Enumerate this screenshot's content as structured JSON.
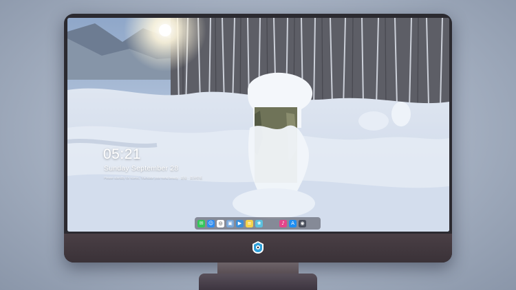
{
  "lock_screen": {
    "time": "05:21",
    "date": "Sunday September  28",
    "subtitle": "Please standby for scenic, Translate your mind beauty · 超级 · 高清壁纸"
  },
  "dock": {
    "apps": [
      {
        "name": "messages",
        "color": "#34c759",
        "glyph": "✉"
      },
      {
        "name": "finder",
        "color": "#2f8cf0",
        "glyph": "☺"
      },
      {
        "name": "safari",
        "color": "#ffffff",
        "glyph": "◎"
      },
      {
        "name": "preview",
        "color": "#7aa7d8",
        "glyph": "▣"
      },
      {
        "name": "movies",
        "color": "#3b8fd9",
        "glyph": "▶"
      },
      {
        "name": "notes",
        "color": "#f5d34a",
        "glyph": "≡"
      },
      {
        "name": "photos",
        "color": "#5bc0de",
        "glyph": "❀"
      },
      {
        "name": "music",
        "color": "#e3458b",
        "glyph": "♪"
      },
      {
        "name": "app-store",
        "color": "#1f8ef1",
        "glyph": "A"
      },
      {
        "name": "camera",
        "color": "#4a4f5c",
        "glyph": "◉"
      }
    ]
  },
  "colors": {
    "frame": "#2b2a30",
    "chin": "#443a40",
    "dock": "#464650"
  }
}
